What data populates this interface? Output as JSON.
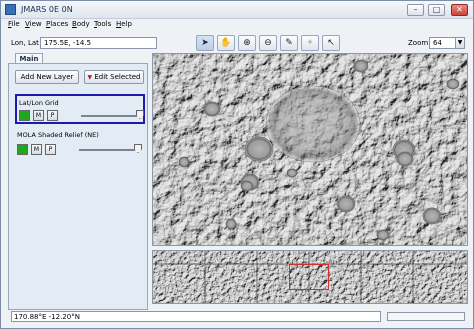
{
  "window": {
    "title": "JMARS 0E 0N"
  },
  "menubar": [
    {
      "key": "F",
      "rest": "ile"
    },
    {
      "key": "V",
      "rest": "iew"
    },
    {
      "key": "P",
      "rest": "laces"
    },
    {
      "key": "B",
      "rest": "ody"
    },
    {
      "key": "T",
      "rest": "ools"
    },
    {
      "key": "H",
      "rest": "elp"
    }
  ],
  "toolbar": {
    "lonlat_label": "Lon, Lat",
    "lonlat_value": "175.5E, -14.5",
    "zoom_label": "Zoom:",
    "zoom_value": "64",
    "tools": [
      "select-pointer-icon",
      "pan-hand-icon",
      "zoom-in-icon",
      "zoom-out-icon",
      "ruler-icon",
      "investigate-star-icon",
      "custom-pointer-icon"
    ]
  },
  "leftpanel": {
    "tab": "Main",
    "add_layer": "Add New Layer",
    "edit_selected": "Edit Selected",
    "layers": [
      {
        "name": "Lat/Lon Grid",
        "btn_m": "M",
        "btn_p": "P",
        "selected": true,
        "opacity": 1.0
      },
      {
        "name": "MOLA Shaded Relief (NE)",
        "btn_m": "M",
        "btn_p": "P",
        "selected": false,
        "opacity": 1.0
      }
    ]
  },
  "status": {
    "coords": "170.88°E -12.20°N"
  },
  "colors": {
    "layer_green": "#1ea81e",
    "selection_border": "#1a1ab0",
    "view_frame": "#d03030"
  }
}
